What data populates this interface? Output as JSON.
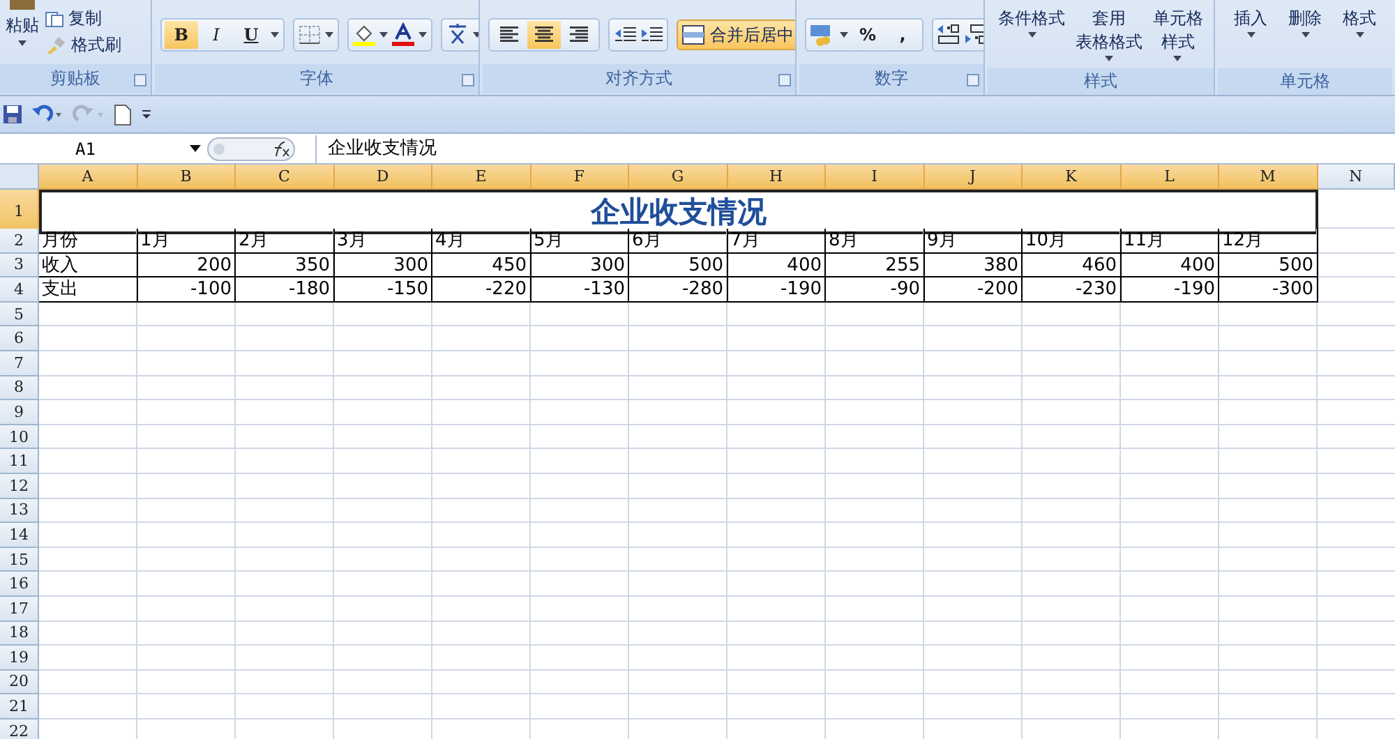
{
  "ribbon": {
    "clipboard": {
      "label": "剪贴板",
      "paste": "粘贴",
      "copy": "复制",
      "format_painter": "格式刷"
    },
    "font": {
      "label": "字体",
      "toggles": [
        {
          "kind": "bold",
          "label": "B",
          "selected": true
        },
        {
          "kind": "italic",
          "label": "I",
          "selected": false
        },
        {
          "kind": "underline",
          "label": "U",
          "selected": false
        }
      ]
    },
    "alignment": {
      "label": "对齐方式",
      "aligns": [
        {
          "kind": "left",
          "selected": false
        },
        {
          "kind": "center",
          "selected": true
        },
        {
          "kind": "right",
          "selected": false
        }
      ],
      "merge": {
        "label": "合并后居中",
        "selected": true
      }
    },
    "number": {
      "label": "数字",
      "percent": "%",
      "comma": ","
    },
    "styles": {
      "label": "样式",
      "buttons": [
        {
          "lines": [
            "条件格式"
          ]
        },
        {
          "lines": [
            "套用",
            "表格格式"
          ]
        },
        {
          "lines": [
            "单元格",
            "样式"
          ]
        }
      ]
    },
    "cells": {
      "label": "单元格",
      "buttons": [
        "插入",
        "删除",
        "格式"
      ]
    }
  },
  "name_box": "A1",
  "formula": "企业收支情况",
  "columns": [
    {
      "label": "A",
      "selected": true
    },
    {
      "label": "B",
      "selected": true
    },
    {
      "label": "C",
      "selected": true
    },
    {
      "label": "D",
      "selected": true
    },
    {
      "label": "E",
      "selected": true
    },
    {
      "label": "F",
      "selected": true
    },
    {
      "label": "G",
      "selected": true
    },
    {
      "label": "H",
      "selected": true
    },
    {
      "label": "I",
      "selected": true
    },
    {
      "label": "J",
      "selected": true
    },
    {
      "label": "K",
      "selected": true
    },
    {
      "label": "L",
      "selected": true
    },
    {
      "label": "M",
      "selected": true
    },
    {
      "label": "N",
      "selected": false
    }
  ],
  "title_row": {
    "label": "1",
    "selected": true,
    "title": "企业收支情况"
  },
  "rows": [
    {
      "label": "2",
      "selected": false,
      "cells": [
        "月份",
        "1月",
        "2月",
        "3月",
        "4月",
        "5月",
        "6月",
        "7月",
        "8月",
        "9月",
        "10月",
        "11月",
        "12月"
      ]
    },
    {
      "label": "3",
      "selected": false,
      "cells": [
        "收入",
        "200",
        "350",
        "300",
        "450",
        "300",
        "500",
        "400",
        "255",
        "380",
        "460",
        "400",
        "500"
      ]
    },
    {
      "label": "4",
      "selected": false,
      "cells": [
        "支出",
        "-100",
        "-180",
        "-150",
        "-220",
        "-130",
        "-280",
        "-190",
        "-90",
        "-200",
        "-230",
        "-190",
        "-300"
      ]
    },
    {
      "label": "5",
      "selected": false
    },
    {
      "label": "6",
      "selected": false
    },
    {
      "label": "7",
      "selected": false
    },
    {
      "label": "8",
      "selected": false
    },
    {
      "label": "9",
      "selected": false
    },
    {
      "label": "10",
      "selected": false
    },
    {
      "label": "11",
      "selected": false
    },
    {
      "label": "12",
      "selected": false
    },
    {
      "label": "13",
      "selected": false
    },
    {
      "label": "14",
      "selected": false
    },
    {
      "label": "15",
      "selected": false
    },
    {
      "label": "16",
      "selected": false
    },
    {
      "label": "17",
      "selected": false
    },
    {
      "label": "18",
      "selected": false
    },
    {
      "label": "19",
      "selected": false
    },
    {
      "label": "20",
      "selected": false
    },
    {
      "label": "21",
      "selected": false
    },
    {
      "label": "22",
      "selected": false
    }
  ]
}
